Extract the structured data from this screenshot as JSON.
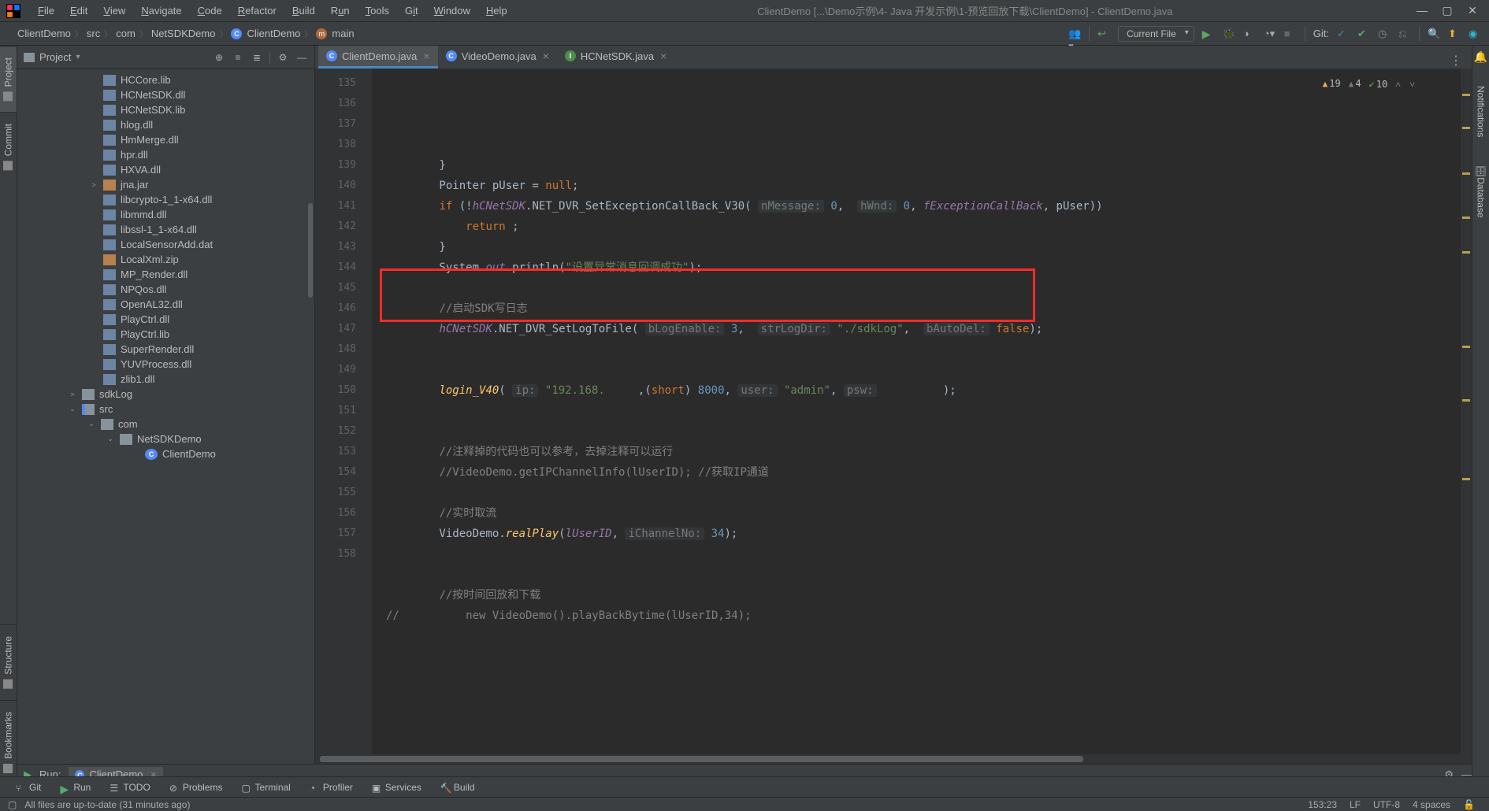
{
  "window_title": "ClientDemo [...\\Demo示例\\4- Java 开发示例\\1-预览回放下载\\ClientDemo] - ClientDemo.java",
  "menus": [
    "File",
    "Edit",
    "View",
    "Navigate",
    "Code",
    "Refactor",
    "Build",
    "Run",
    "Tools",
    "Git",
    "Window",
    "Help"
  ],
  "breadcrumbs": [
    "ClientDemo",
    "src",
    "com",
    "NetSDKDemo",
    "ClientDemo",
    "main"
  ],
  "run_config": "Current File",
  "git_label": "Git:",
  "side_tabs_left": [
    "Project",
    "Commit",
    "Structure",
    "Bookmarks"
  ],
  "side_tabs_right": [
    "Notifications",
    "Database"
  ],
  "project_panel_title": "Project",
  "tree": {
    "files": [
      {
        "name": "HCCore.lib",
        "ico": "fico-lib",
        "ind": 85
      },
      {
        "name": "HCNetSDK.dll",
        "ico": "fico-dll",
        "ind": 85
      },
      {
        "name": "HCNetSDK.lib",
        "ico": "fico-lib",
        "ind": 85
      },
      {
        "name": "hlog.dll",
        "ico": "fico-dll",
        "ind": 85
      },
      {
        "name": "HmMerge.dll",
        "ico": "fico-dll",
        "ind": 85
      },
      {
        "name": "hpr.dll",
        "ico": "fico-dll",
        "ind": 85
      },
      {
        "name": "HXVA.dll",
        "ico": "fico-dll",
        "ind": 85
      },
      {
        "name": "jna.jar",
        "ico": "fico-jar",
        "ind": 85,
        "arw": ">"
      },
      {
        "name": "libcrypto-1_1-x64.dll",
        "ico": "fico-dll",
        "ind": 85
      },
      {
        "name": "libmmd.dll",
        "ico": "fico-dll",
        "ind": 85
      },
      {
        "name": "libssl-1_1-x64.dll",
        "ico": "fico-dll",
        "ind": 85
      },
      {
        "name": "LocalSensorAdd.dat",
        "ico": "fico-dat",
        "ind": 85
      },
      {
        "name": "LocalXml.zip",
        "ico": "fico-zip",
        "ind": 85
      },
      {
        "name": "MP_Render.dll",
        "ico": "fico-dll",
        "ind": 85
      },
      {
        "name": "NPQos.dll",
        "ico": "fico-dll",
        "ind": 85
      },
      {
        "name": "OpenAL32.dll",
        "ico": "fico-dll",
        "ind": 85
      },
      {
        "name": "PlayCtrl.dll",
        "ico": "fico-dll",
        "ind": 85
      },
      {
        "name": "PlayCtrl.lib",
        "ico": "fico-lib",
        "ind": 85
      },
      {
        "name": "SuperRender.dll",
        "ico": "fico-dll",
        "ind": 85
      },
      {
        "name": "YUVProcess.dll",
        "ico": "fico-dll",
        "ind": 85
      },
      {
        "name": "zlib1.dll",
        "ico": "fico-dll",
        "ind": 85
      },
      {
        "name": "sdkLog",
        "ico": "fico-fold",
        "ind": 58,
        "arw": ">"
      },
      {
        "name": "src",
        "ico": "fico-foldv",
        "ind": 58,
        "arw": "⌄"
      },
      {
        "name": "com",
        "ico": "fico-fold",
        "ind": 82,
        "arw": "⌄"
      },
      {
        "name": "NetSDKDemo",
        "ico": "fico-fold",
        "ind": 106,
        "arw": "⌄"
      },
      {
        "name": "ClientDemo",
        "ico": "fico-cls",
        "ind": 138
      }
    ]
  },
  "tabs": [
    {
      "label": "ClientDemo.java",
      "ico": "ti-c",
      "active": true
    },
    {
      "label": "VideoDemo.java",
      "ico": "ti-c",
      "active": false
    },
    {
      "label": "HCNetSDK.java",
      "ico": "ti-i",
      "active": false
    }
  ],
  "inspections": {
    "warn": "19",
    "weak": "4",
    "typo": "10"
  },
  "code": {
    "first_line": 135,
    "lines": [
      "        }",
      "        Pointer pUser = <kw>null</kw>;",
      "        <kw>if</kw> (!<fld>hCNetSDK</fld>.NET_DVR_SetExceptionCallBack_V30( <hint>nMessage:</hint> <num>0</num>,  <hint>hWnd:</hint> <num>0</num>, <fld>fExceptionCallBack</fld>, pUser))",
      "            <kw>return</kw> ;",
      "        }",
      "        System.<fld>out</fld>.println(<str>\"设置异常消息回调成功\"</str>);",
      "",
      "        <cmt>//启动SDK写日志</cmt>",
      "        <fld>hCNetSDK</fld>.NET_DVR_SetLogToFile( <hint>bLogEnable:</hint> <num>3</num>,  <hint>strLogDir:</hint> <str>\"./sdkLog\"</str>,  <hint>bAutoDel:</hint> <kw>false</kw>);",
      "",
      "",
      "        <mth>login_V40</mth>( <hint>ip:</hint> <str>\"192.168.&#8203;     &#8203;</str>,(<kw>short</kw>) <num>8000</num>, <hint>user:</hint> <str>\"admin\"</str>, <hint>psw:</hint> <str>&#8203;         &#8203;</str>);",
      "",
      "",
      "        <cmt>//注释掉的代码也可以参考，去掉注释可以运行</cmt>",
      "        <cmt>//VideoDemo.getIPChannelInfo(lUserID); //获取IP通道</cmt>",
      "",
      "        <cmt>//实时取流</cmt>",
      "        VideoDemo.<mth>realPlay</mth>(<fld>lUserID</fld>, <hint>iChannelNo:</hint> <num>34</num>);",
      "",
      "",
      "        <cmt>//按时间回放和下载</cmt>",
      "<cmt>//          new VideoDemo().playBackBytime(lUserID,34);</cmt>",
      ""
    ]
  },
  "run_panel": {
    "label": "Run:",
    "tab": "ClientDemo"
  },
  "bottom_tools": [
    "Git",
    "Run",
    "TODO",
    "Problems",
    "Terminal",
    "Profiler",
    "Services",
    "Build"
  ],
  "status": {
    "msg": "All files are up-to-date (31 minutes ago)",
    "pos": "153:23",
    "le": "LF",
    "enc": "UTF-8",
    "indent": "4 spaces"
  }
}
